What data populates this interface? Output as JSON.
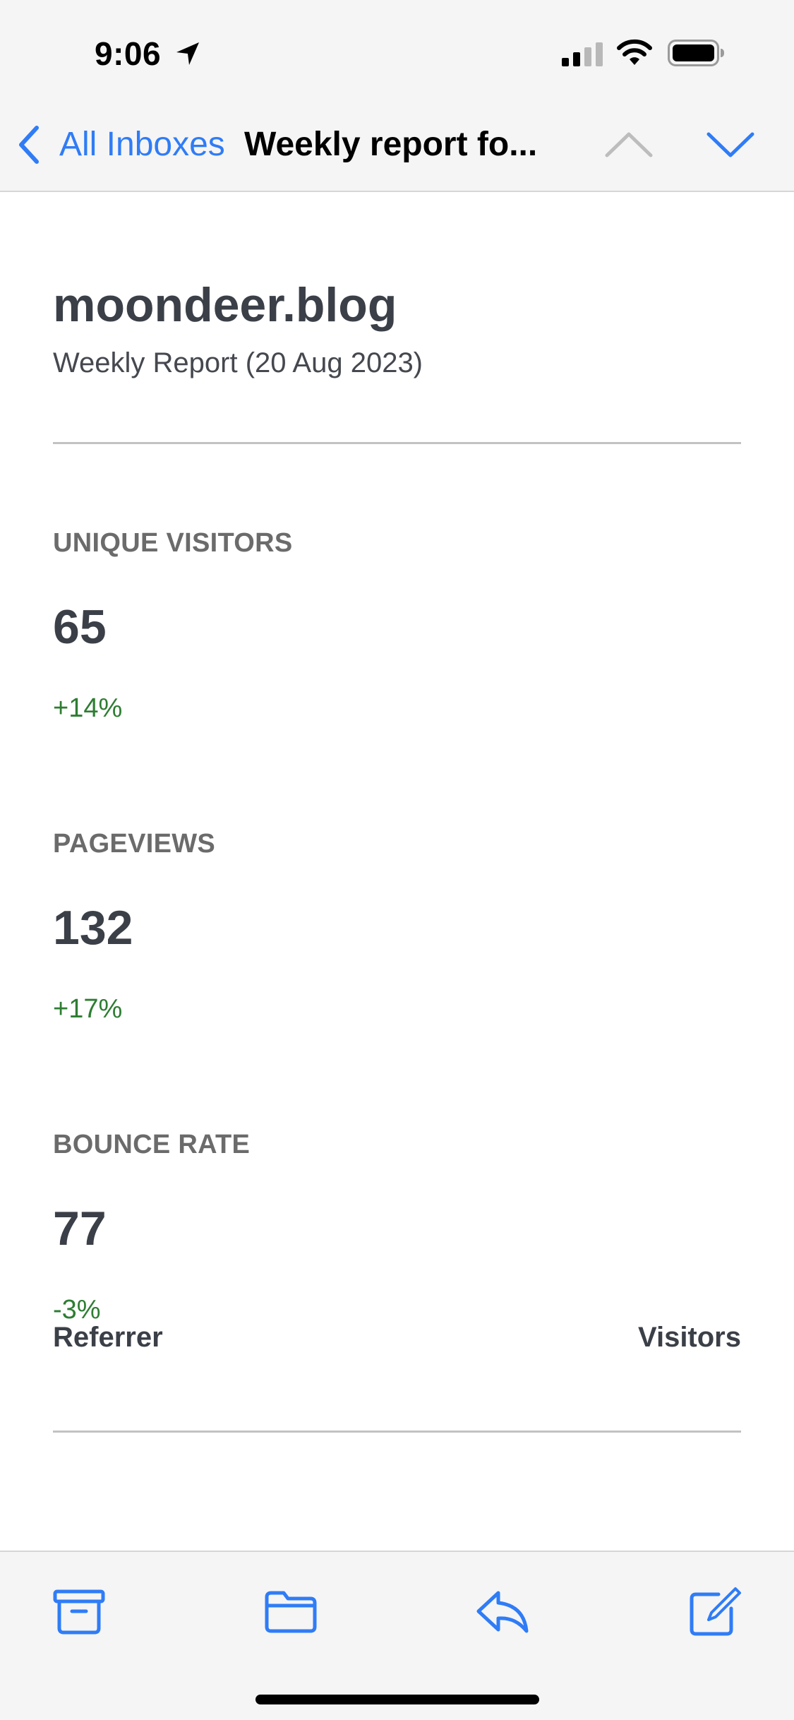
{
  "status_bar": {
    "time": "9:06",
    "icons": [
      "location-arrow-icon",
      "cellular-signal-icon",
      "wifi-icon",
      "battery-icon"
    ]
  },
  "nav": {
    "back_label": "All Inboxes",
    "title": "Weekly report fo...",
    "icons": [
      "back-chevron-icon",
      "chevron-up-icon",
      "chevron-down-icon"
    ]
  },
  "email": {
    "site_title": "moondeer.blog",
    "subtitle": "Weekly Report (20 Aug 2023)",
    "metrics": [
      {
        "label": "UNIQUE VISITORS",
        "value": "65",
        "change": "+14%"
      },
      {
        "label": "PAGEVIEWS",
        "value": "132",
        "change": "+17%"
      },
      {
        "label": "BOUNCE RATE",
        "value": "77",
        "change": "-3%"
      }
    ],
    "table": {
      "headers": [
        "Referrer",
        "Visitors"
      ]
    }
  },
  "toolbar": {
    "items": [
      "archive-icon",
      "folder-icon",
      "reply-icon",
      "compose-icon"
    ]
  },
  "colors": {
    "accent": "#2f7cf6",
    "positive": "#2e7d32",
    "text_dark": "#3b3f47",
    "label_gray": "#6b6b6b",
    "chrome_bg": "#f5f5f5",
    "nav_disabled": "#bdbdbd"
  }
}
